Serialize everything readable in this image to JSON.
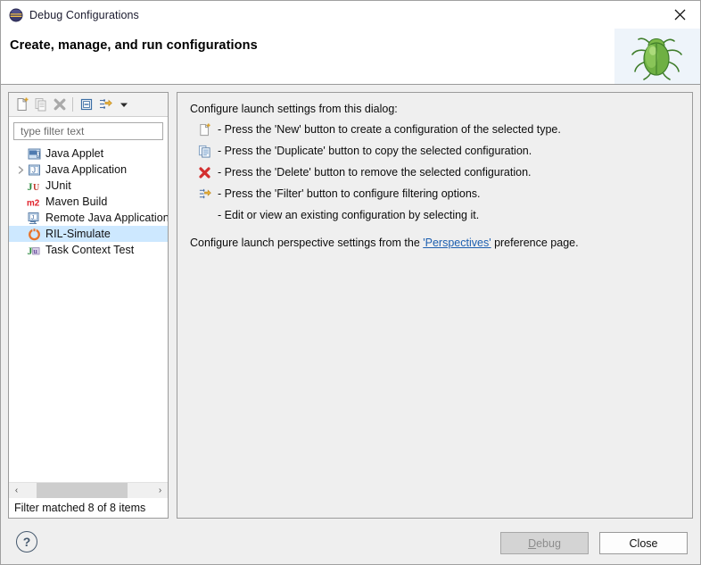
{
  "window": {
    "title": "Debug Configurations",
    "icon": "eclipse-debug-icon",
    "close_label": "✕"
  },
  "header": {
    "title": "Create, manage, and run configurations",
    "art_icon": "green-bug-icon"
  },
  "toolbar": {
    "buttons": [
      {
        "name": "new-configuration-button",
        "label": "New",
        "enabled": true
      },
      {
        "name": "duplicate-configuration-button",
        "label": "Duplicate",
        "enabled": false
      },
      {
        "name": "delete-configuration-button",
        "label": "Delete",
        "enabled": false
      },
      {
        "name": "collapse-all-button",
        "label": "Collapse All",
        "enabled": true
      },
      {
        "name": "filter-button",
        "label": "Filter",
        "enabled": true
      },
      {
        "name": "view-menu-button",
        "label": "View Menu",
        "enabled": true
      }
    ]
  },
  "filter": {
    "value": "",
    "placeholder": "type filter text"
  },
  "tree": {
    "items": [
      {
        "label": "Java Applet",
        "icon": "java-applet-icon",
        "expandable": false,
        "selected": false
      },
      {
        "label": "Java Application",
        "icon": "java-application-icon",
        "expandable": true,
        "selected": false
      },
      {
        "label": "JUnit",
        "icon": "junit-icon",
        "expandable": false,
        "selected": false
      },
      {
        "label": "Maven Build",
        "icon": "maven-icon",
        "expandable": false,
        "selected": false
      },
      {
        "label": "Remote Java Application",
        "icon": "remote-java-application-icon",
        "expandable": false,
        "selected": false
      },
      {
        "label": "RIL-Simulate",
        "icon": "ril-simulate-icon",
        "expandable": false,
        "selected": true
      },
      {
        "label": "Task Context Test",
        "icon": "task-context-test-icon",
        "expandable": false,
        "selected": false
      }
    ],
    "status": "Filter matched 8 of 8 items",
    "scroll_left_label": "‹",
    "scroll_right_label": "›"
  },
  "main": {
    "intro": "Configure launch settings from this dialog:",
    "bullets": [
      {
        "icon": "new-icon",
        "text": "- Press the 'New' button to create a configuration of the selected type."
      },
      {
        "icon": "duplicate-icon",
        "text": "- Press the 'Duplicate' button to copy the selected configuration."
      },
      {
        "icon": "delete-icon",
        "text": "- Press the 'Delete' button to remove the selected configuration."
      },
      {
        "icon": "filter-icon",
        "text": "- Press the 'Filter' button to configure filtering options."
      },
      {
        "icon": "none",
        "text": "- Edit or view an existing configuration by selecting it."
      }
    ],
    "outro_before": "Configure launch perspective settings from the ",
    "outro_link": "'Perspectives'",
    "outro_after": " preference page."
  },
  "footer": {
    "help_label": "?",
    "debug_label": "Debug",
    "debug_mnemonic": "D",
    "debug_rest": "ebug",
    "debug_enabled": false,
    "close_label": "Close",
    "close_enabled": true
  },
  "colors": {
    "selection": "#cde8ff",
    "link": "#1d5fb0",
    "accent_orange": "#e8732a",
    "dialog_bg": "#efefef"
  }
}
